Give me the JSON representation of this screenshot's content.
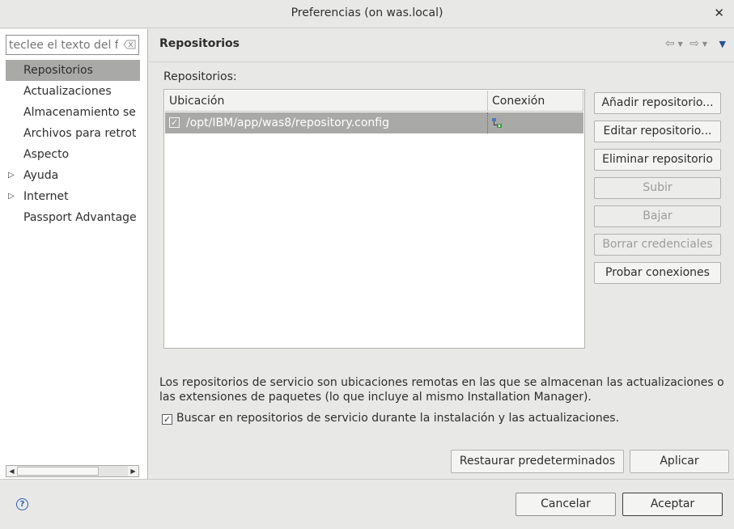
{
  "window": {
    "title": "Preferencias  (on was.local)",
    "close_symbol": "✕"
  },
  "sidebar": {
    "filter_placeholder": "teclee el texto del filtro",
    "items": [
      {
        "label": "Repositorios",
        "selected": true,
        "expandable": false
      },
      {
        "label": "Actualizaciones",
        "selected": false,
        "expandable": false
      },
      {
        "label": "Almacenamiento se",
        "selected": false,
        "expandable": false
      },
      {
        "label": "Archivos para retrot",
        "selected": false,
        "expandable": false
      },
      {
        "label": "Aspecto",
        "selected": false,
        "expandable": false
      },
      {
        "label": "Ayuda",
        "selected": false,
        "expandable": true
      },
      {
        "label": "Internet",
        "selected": false,
        "expandable": true
      },
      {
        "label": "Passport Advantage",
        "selected": false,
        "expandable": false
      }
    ]
  },
  "page": {
    "title": "Repositorios",
    "section_label": "Repositorios:",
    "table": {
      "columns": [
        "Ubicación",
        "Conexión"
      ],
      "rows": [
        {
          "checked": true,
          "location": "/opt/IBM/app/was8/repository.config",
          "connection_icon": "network-connection-icon"
        }
      ]
    },
    "buttons": {
      "add": "Añadir repositorio...",
      "edit": "Editar repositorio...",
      "remove": "Eliminar repositorio",
      "up": "Subir",
      "down": "Bajar",
      "clear_credentials": "Borrar credenciales",
      "test_connections": "Probar conexiones"
    },
    "description": "Los repositorios de servicio son ubicaciones remotas en las que se almacenan las actualizaciones o las extensiones de paquetes (lo que incluye al mismo Installation Manager).",
    "search_service_repos_label": "Buscar en repositorios de servicio durante la instalación y las actualizaciones.",
    "search_service_repos_checked": true,
    "restore_defaults": "Restaurar predeterminados",
    "apply": "Aplicar"
  },
  "footer": {
    "help_symbol": "?",
    "cancel": "Cancelar",
    "ok": "Aceptar"
  }
}
